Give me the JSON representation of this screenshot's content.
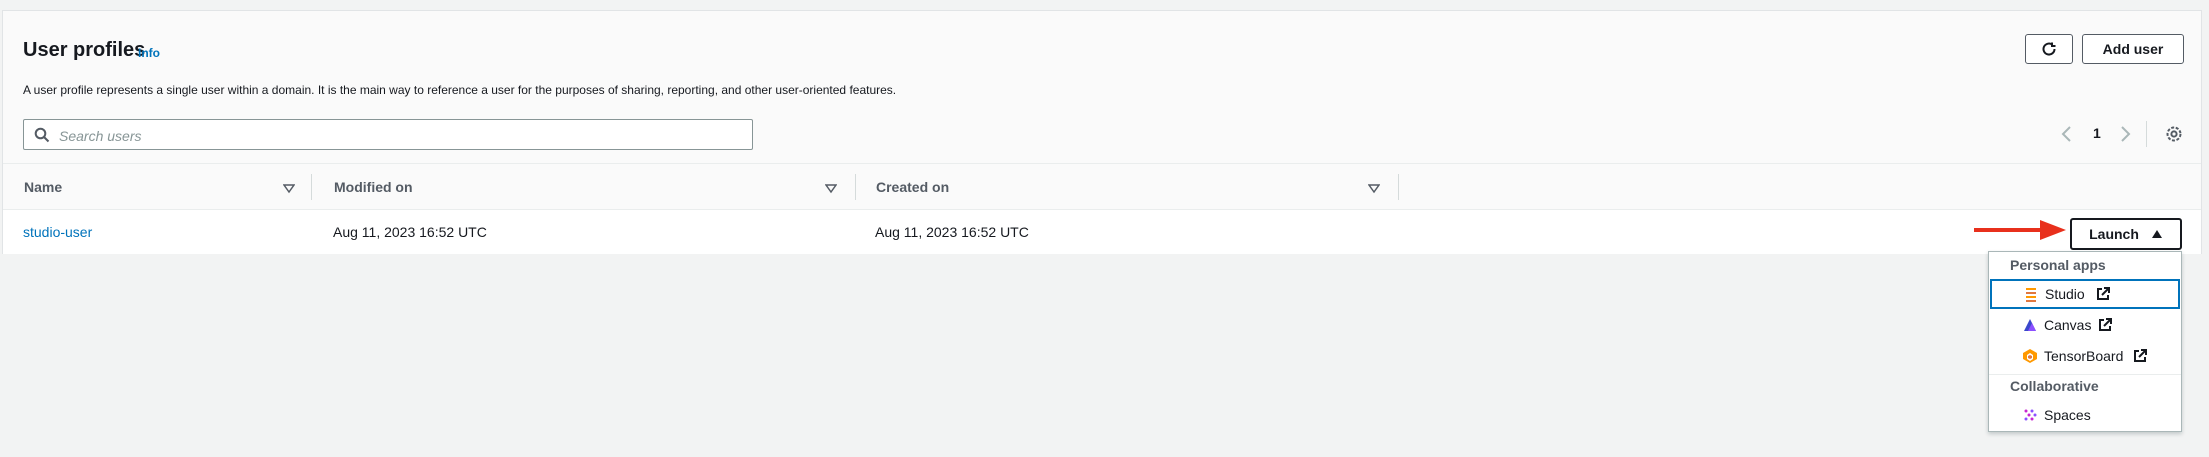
{
  "header": {
    "title": "User profiles",
    "info_label": "Info",
    "description": "A user profile represents a single user within a domain. It is the main way to reference a user for the purposes of sharing, reporting, and other user-oriented features.",
    "add_user_label": "Add user"
  },
  "search": {
    "placeholder": "Search users"
  },
  "pagination": {
    "current_page": "1"
  },
  "table": {
    "columns": [
      "Name",
      "Modified on",
      "Created on"
    ],
    "rows": [
      {
        "name": "studio-user",
        "modified_on": "Aug 11, 2023 16:52 UTC",
        "created_on": "Aug 11, 2023 16:52 UTC"
      }
    ]
  },
  "launch": {
    "label": "Launch",
    "menu": {
      "personal_heading": "Personal apps",
      "personal_items": [
        "Studio",
        "Canvas",
        "TensorBoard"
      ],
      "collab_heading": "Collaborative",
      "collab_items": [
        "Spaces"
      ]
    }
  },
  "colors": {
    "accent": "#0073bb",
    "arrow": "#e8301c"
  }
}
